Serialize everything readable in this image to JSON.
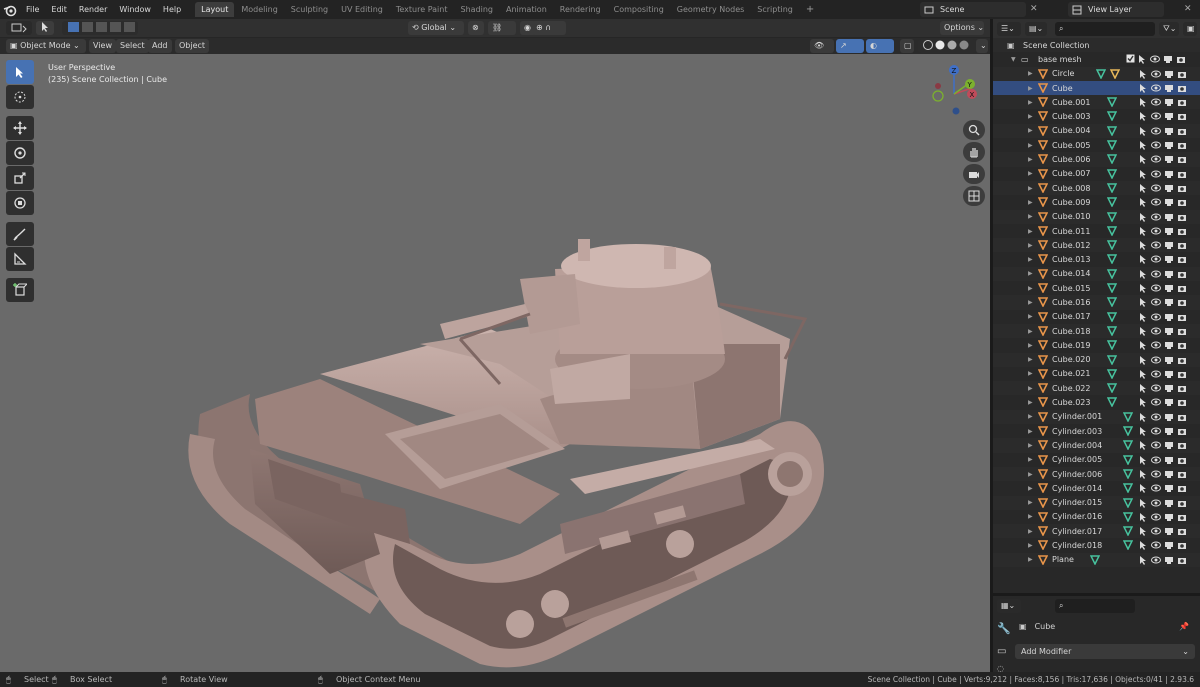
{
  "topbar": {
    "menus": [
      "File",
      "Edit",
      "Render",
      "Window",
      "Help"
    ],
    "tabs": [
      {
        "label": "Layout",
        "active": true
      },
      {
        "label": "Modeling"
      },
      {
        "label": "Sculpting"
      },
      {
        "label": "UV Editing"
      },
      {
        "label": "Texture Paint"
      },
      {
        "label": "Shading"
      },
      {
        "label": "Animation"
      },
      {
        "label": "Rendering"
      },
      {
        "label": "Compositing"
      },
      {
        "label": "Geometry Nodes"
      },
      {
        "label": "Scripting"
      }
    ],
    "add_tab": "+",
    "scene": "Scene",
    "view_layer": "View Layer"
  },
  "viewport_header": {
    "mode": "Object Mode",
    "menus": [
      "View",
      "Select",
      "Add",
      "Object"
    ],
    "orientation": "Global",
    "options": "Options"
  },
  "viewport": {
    "perspective": "User Perspective",
    "context": "(235) Scene Collection | Cube",
    "axis_x": "X",
    "axis_y": "Y",
    "axis_z": "Z"
  },
  "outliner": {
    "root": "Scene Collection",
    "collection": "base mesh",
    "objects": [
      {
        "name": "Circle",
        "type": "mesh",
        "mods": 2
      },
      {
        "name": "Cube",
        "type": "mesh",
        "mods": 0,
        "selected": true
      },
      {
        "name": "Cube.001",
        "type": "mesh",
        "mods": 1
      },
      {
        "name": "Cube.003",
        "type": "mesh",
        "mods": 1
      },
      {
        "name": "Cube.004",
        "type": "mesh",
        "mods": 1
      },
      {
        "name": "Cube.005",
        "type": "mesh",
        "mods": 1
      },
      {
        "name": "Cube.006",
        "type": "mesh",
        "mods": 1
      },
      {
        "name": "Cube.007",
        "type": "mesh",
        "mods": 1
      },
      {
        "name": "Cube.008",
        "type": "mesh",
        "mods": 1
      },
      {
        "name": "Cube.009",
        "type": "mesh",
        "mods": 1
      },
      {
        "name": "Cube.010",
        "type": "mesh",
        "mods": 1
      },
      {
        "name": "Cube.011",
        "type": "mesh",
        "mods": 1
      },
      {
        "name": "Cube.012",
        "type": "mesh",
        "mods": 1
      },
      {
        "name": "Cube.013",
        "type": "mesh",
        "mods": 1
      },
      {
        "name": "Cube.014",
        "type": "mesh",
        "mods": 1
      },
      {
        "name": "Cube.015",
        "type": "mesh",
        "mods": 1
      },
      {
        "name": "Cube.016",
        "type": "mesh",
        "mods": 1
      },
      {
        "name": "Cube.017",
        "type": "mesh",
        "mods": 1
      },
      {
        "name": "Cube.018",
        "type": "mesh",
        "mods": 1
      },
      {
        "name": "Cube.019",
        "type": "mesh",
        "mods": 1
      },
      {
        "name": "Cube.020",
        "type": "mesh",
        "mods": 1
      },
      {
        "name": "Cube.021",
        "type": "mesh",
        "mods": 1
      },
      {
        "name": "Cube.022",
        "type": "mesh",
        "mods": 1
      },
      {
        "name": "Cube.023",
        "type": "mesh",
        "mods": 1
      },
      {
        "name": "Cylinder.001",
        "type": "mesh",
        "mods": 1
      },
      {
        "name": "Cylinder.003",
        "type": "mesh",
        "mods": 1
      },
      {
        "name": "Cylinder.004",
        "type": "mesh",
        "mods": 1
      },
      {
        "name": "Cylinder.005",
        "type": "mesh",
        "mods": 1
      },
      {
        "name": "Cylinder.006",
        "type": "mesh",
        "mods": 1
      },
      {
        "name": "Cylinder.014",
        "type": "mesh",
        "mods": 1
      },
      {
        "name": "Cylinder.015",
        "type": "mesh",
        "mods": 1
      },
      {
        "name": "Cylinder.016",
        "type": "mesh",
        "mods": 1
      },
      {
        "name": "Cylinder.017",
        "type": "mesh",
        "mods": 1
      },
      {
        "name": "Cylinder.018",
        "type": "mesh",
        "mods": 1
      },
      {
        "name": "Plane",
        "type": "mesh",
        "mods": 1
      }
    ]
  },
  "properties": {
    "object_name": "Cube",
    "add_modifier": "Add Modifier"
  },
  "statusbar": {
    "select": "Select",
    "box_select": "Box Select",
    "rotate_view": "Rotate View",
    "context_menu": "Object Context Menu",
    "stats": "Scene Collection | Cube | Verts:9,212 | Faces:8,156 | Tris:17,636 | Objects:0/41 | 2.93.6"
  },
  "colors": {
    "accent": "#4772b3",
    "mesh_icon": "#e8954a",
    "modifier_icon": "#47c29e",
    "selected_row": "#334d80"
  }
}
